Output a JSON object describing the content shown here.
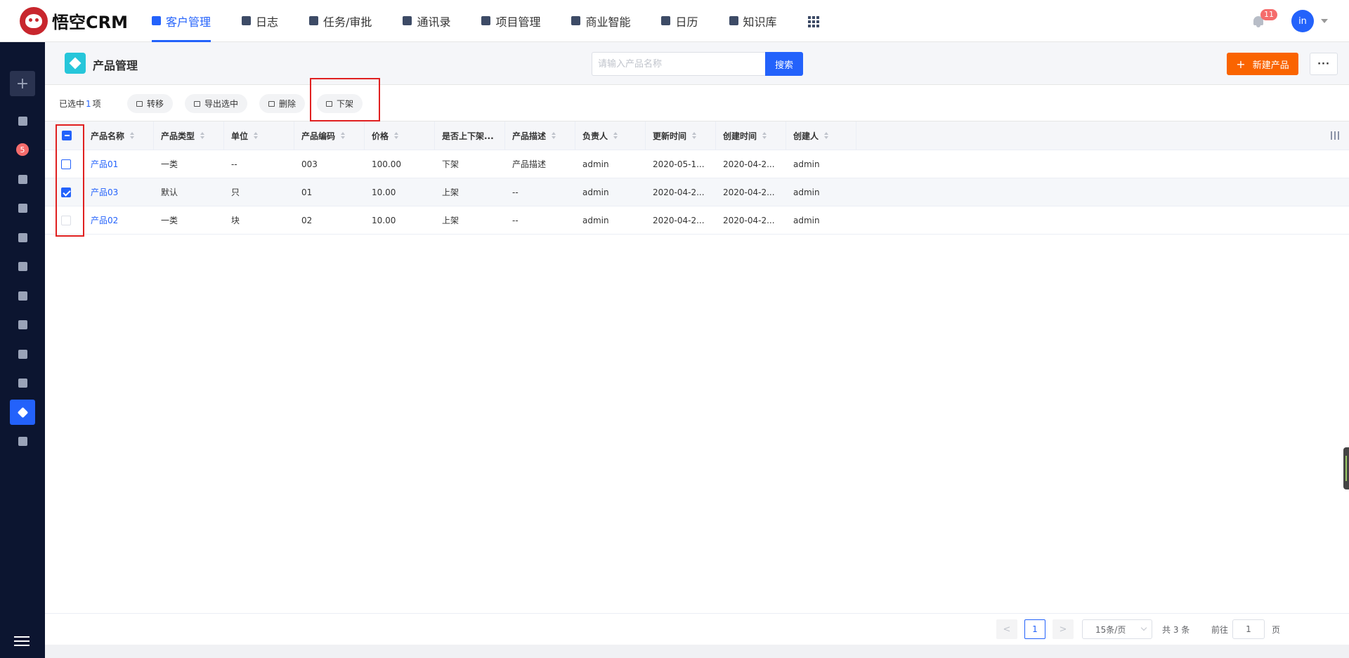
{
  "app": {
    "logo_text": "悟空CRM"
  },
  "nav": {
    "items": [
      {
        "label": "客户管理",
        "icon": "building-icon",
        "active": true
      },
      {
        "label": "日志",
        "icon": "journal-icon",
        "active": false
      },
      {
        "label": "任务/审批",
        "icon": "briefcase-icon",
        "active": false
      },
      {
        "label": "通讯录",
        "icon": "phone-icon",
        "active": false
      },
      {
        "label": "项目管理",
        "icon": "list-icon",
        "active": false
      },
      {
        "label": "商业智能",
        "icon": "bi-icon",
        "active": false
      },
      {
        "label": "日历",
        "icon": "calendar-icon",
        "active": false
      },
      {
        "label": "知识库",
        "icon": "book-icon",
        "active": false
      }
    ],
    "notification_count": "11",
    "avatar_text": "in"
  },
  "sidebar": {
    "add_label": "+",
    "badge_count": "5"
  },
  "page": {
    "title": "产品管理",
    "search_placeholder": "请输入产品名称",
    "search_label": "搜索",
    "new_label": "新建产品",
    "new_plus": "+",
    "more_label": "···"
  },
  "toolbar": {
    "selected_prefix": "已选中",
    "selected_count": "1",
    "selected_suffix": "项",
    "actions": [
      "转移",
      "导出选中",
      "删除",
      "下架"
    ]
  },
  "table": {
    "headers": [
      "产品名称",
      "产品类型",
      "单位",
      "产品编码",
      "价格",
      "是否上下架...",
      "产品描述",
      "负责人",
      "更新时间",
      "创建时间",
      "创建人"
    ],
    "rows": [
      {
        "checked": false,
        "cells": [
          "产品01",
          "一类",
          "--",
          "003",
          "100.00",
          "下架",
          "产品描述",
          "admin",
          "2020-05-1...",
          "2020-04-2...",
          "admin"
        ]
      },
      {
        "checked": true,
        "cells": [
          "产品03",
          "默认",
          "只",
          "01",
          "10.00",
          "上架",
          "--",
          "admin",
          "2020-04-2...",
          "2020-04-2...",
          "admin"
        ]
      },
      {
        "checked": false,
        "cells": [
          "产品02",
          "一类",
          "块",
          "02",
          "10.00",
          "上架",
          "--",
          "admin",
          "2020-04-2...",
          "2020-04-2...",
          "admin"
        ]
      }
    ]
  },
  "pagination": {
    "prev": "<",
    "current": "1",
    "next": ">",
    "page_size": "15条/页",
    "total": "共 3 条",
    "goto_prefix": "前往",
    "goto_value": "1",
    "goto_suffix": "页"
  },
  "colors": {
    "primary": "#2362fb",
    "accent": "#fa6400",
    "sidebar": "#0c1530",
    "annotation": "#e02020"
  }
}
